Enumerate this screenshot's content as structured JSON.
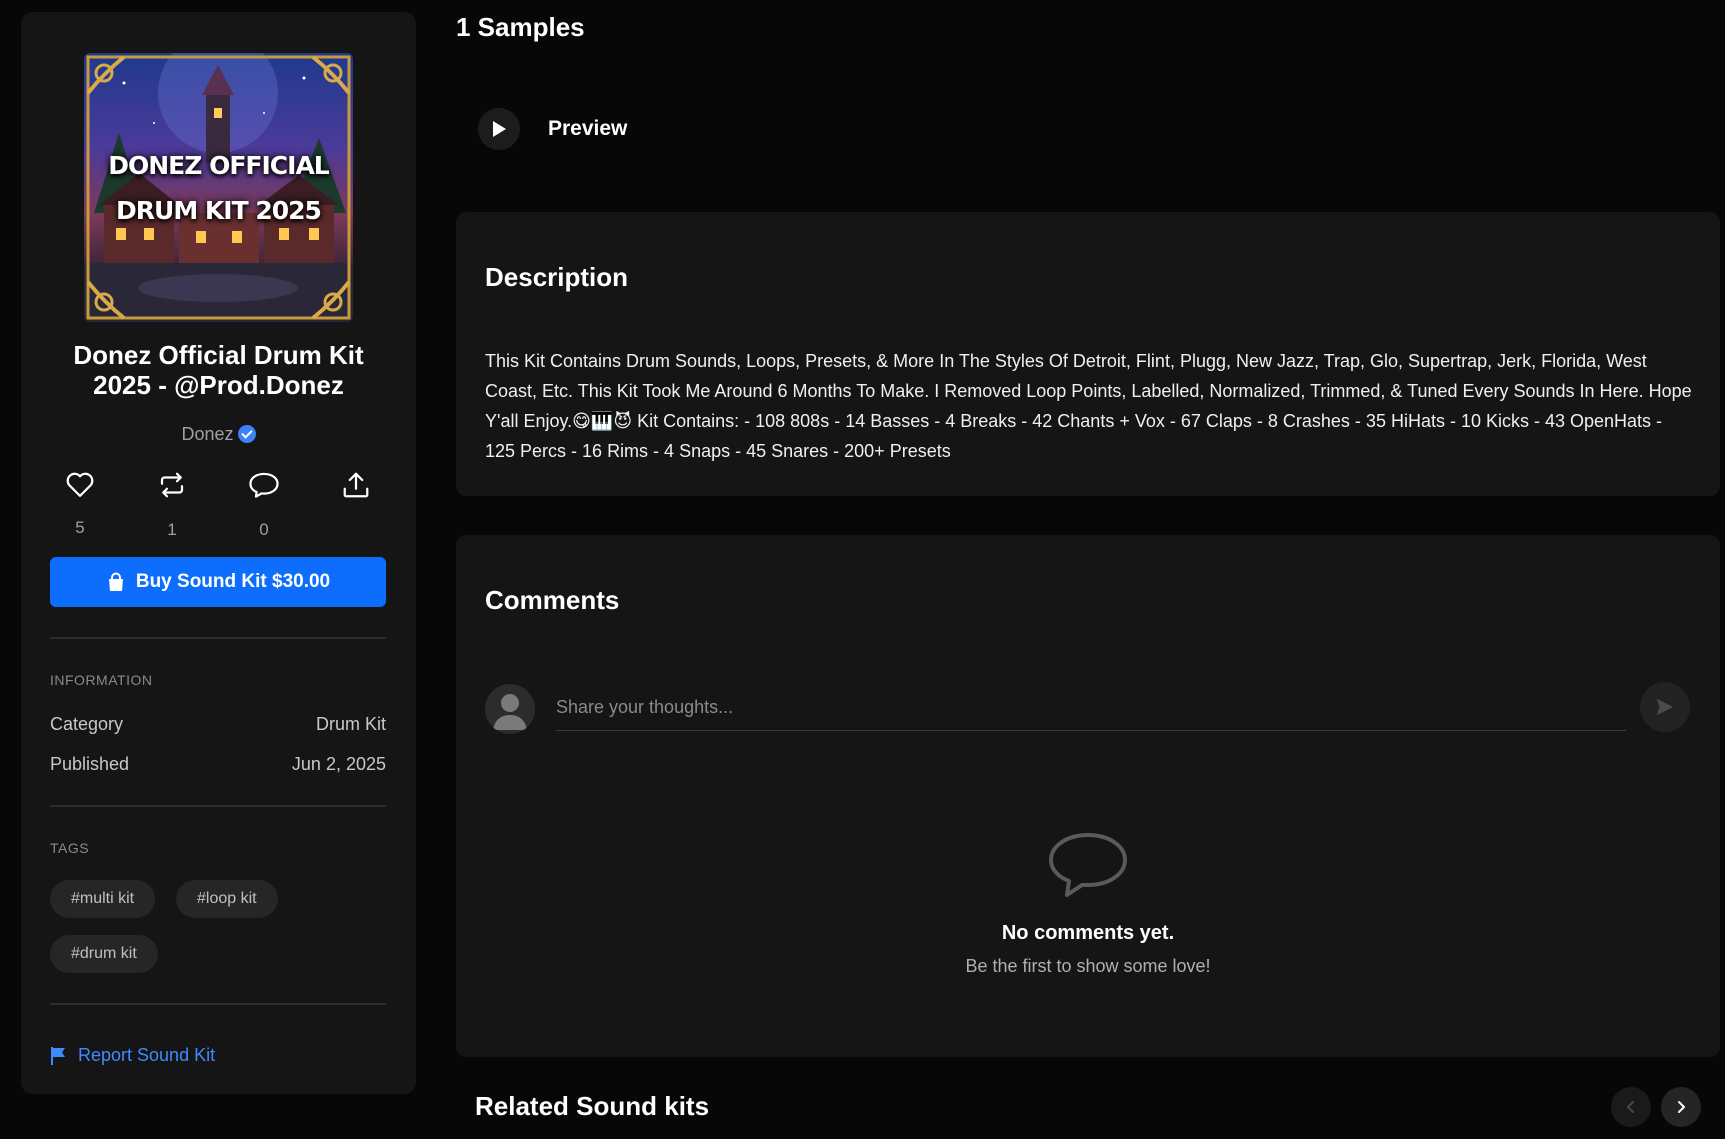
{
  "sidebar": {
    "cover": {
      "line1": "DONEZ OFFICIAL",
      "line2": "DRUM KIT 2025"
    },
    "title": "Donez Official Drum Kit 2025 - @Prod.Donez",
    "author": "Donez",
    "actions": {
      "likes": "5",
      "reposts": "1",
      "comments": "0"
    },
    "buy_label": "Buy Sound Kit $30.00",
    "information": {
      "heading": "INFORMATION",
      "category_label": "Category",
      "category_value": "Drum Kit",
      "published_label": "Published",
      "published_value": "Jun 2, 2025"
    },
    "tags": {
      "heading": "TAGS",
      "items": [
        "#multi kit",
        "#loop kit",
        "#drum kit"
      ]
    },
    "report_label": "Report Sound Kit"
  },
  "main": {
    "samples_title": "1 Samples",
    "preview_label": "Preview",
    "description": {
      "title": "Description",
      "text": "This Kit Contains Drum Sounds, Loops, Presets, & More In The Styles Of Detroit, Flint, Plugg, New Jazz, Trap, Glo, Supertrap, Jerk, Florida, West Coast, Etc. This Kit Took Me Around 6 Months To Make. I Removed Loop Points, Labelled, Normalized, Trimmed, & Tuned Every Sounds In Here. Hope Y'all Enjoy.😋🎹😈 Kit Contains: - 108 808s - 14 Basses - 4 Breaks - 42 Chants + Vox - 67 Claps - 8 Crashes - 35 HiHats - 10 Kicks - 43 OpenHats - 125 Percs - 16 Rims - 4 Snaps - 45 Snares - 200+ Presets"
    },
    "comments": {
      "title": "Comments",
      "placeholder": "Share your thoughts...",
      "empty_title": "No comments yet.",
      "empty_subtitle": "Be the first to show some love!"
    },
    "related_title": "Related Sound kits"
  },
  "colors": {
    "background": "#070707",
    "panel": "#151515",
    "accent": "#0d6efd",
    "link": "#3d8bff"
  }
}
